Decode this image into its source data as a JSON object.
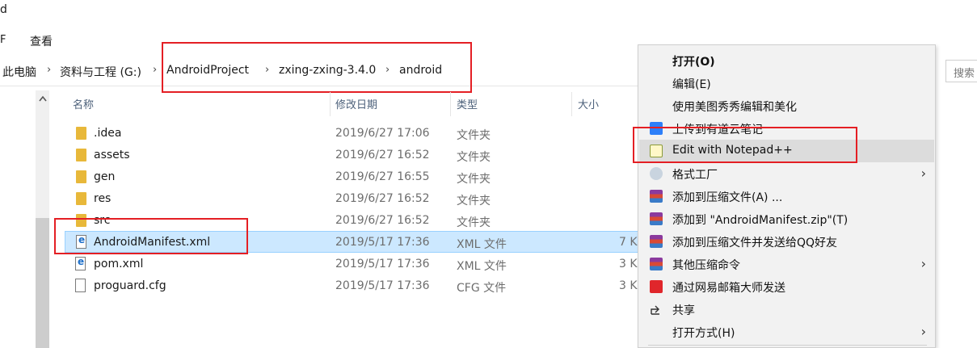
{
  "window": {
    "title_fragment": "d"
  },
  "ribbon": {
    "fragment": "F",
    "view_tab": "查看"
  },
  "address": {
    "crumbs": [
      "此电脑",
      "资料与工程 (G:)",
      "AndroidProject",
      "zxing-zxing-3.4.0",
      "android"
    ],
    "separator": "›"
  },
  "search": {
    "placeholder": "搜索"
  },
  "columns": {
    "name": "名称",
    "date": "修改日期",
    "type": "类型",
    "size": "大小"
  },
  "files": [
    {
      "name": ".idea",
      "date": "2019/6/27 17:06",
      "type": "文件夹",
      "size": "",
      "icon": "folder-icon"
    },
    {
      "name": "assets",
      "date": "2019/6/27 16:52",
      "type": "文件夹",
      "size": "",
      "icon": "folder-icon"
    },
    {
      "name": "gen",
      "date": "2019/6/27 16:55",
      "type": "文件夹",
      "size": "",
      "icon": "folder-icon"
    },
    {
      "name": "res",
      "date": "2019/6/27 16:52",
      "type": "文件夹",
      "size": "",
      "icon": "folder-icon"
    },
    {
      "name": "src",
      "date": "2019/6/27 16:52",
      "type": "文件夹",
      "size": "",
      "icon": "folder-icon"
    },
    {
      "name": "AndroidManifest.xml",
      "date": "2019/5/17 17:36",
      "type": "XML 文件",
      "size": "7 K",
      "icon": "xml-file-icon",
      "selected": true
    },
    {
      "name": "pom.xml",
      "date": "2019/5/17 17:36",
      "type": "XML 文件",
      "size": "3 K",
      "icon": "xml-file-icon"
    },
    {
      "name": "proguard.cfg",
      "date": "2019/5/17 17:36",
      "type": "CFG 文件",
      "size": "3 K",
      "icon": "file-icon"
    }
  ],
  "context_menu": {
    "items": [
      {
        "label": "打开(O)",
        "bold": true,
        "icon": ""
      },
      {
        "label": "编辑(E)",
        "icon": ""
      },
      {
        "label": "使用美图秀秀编辑和美化",
        "icon": ""
      },
      {
        "label": "上传到有道云笔记",
        "icon": "youdao-icon"
      },
      {
        "label": "Edit with Notepad++",
        "icon": "notepad-plus-plus-icon",
        "hover": true
      },
      {
        "label": "格式工厂",
        "icon": "format-factory-icon",
        "submenu": true
      },
      {
        "label": "添加到压缩文件(A) ...",
        "icon": "winrar-icon"
      },
      {
        "label": "添加到 \"AndroidManifest.zip\"(T)",
        "icon": "winrar-icon"
      },
      {
        "label": "添加到压缩文件并发送给QQ好友",
        "icon": "winrar-icon"
      },
      {
        "label": "其他压缩命令",
        "icon": "winrar-icon",
        "submenu": true
      },
      {
        "label": "通过网易邮箱大师发送",
        "icon": "netease-mail-icon"
      },
      {
        "label": "共享",
        "icon": "share-icon"
      },
      {
        "label": "打开方式(H)",
        "icon": "",
        "submenu": true
      }
    ],
    "arrow": "›"
  },
  "colors": {
    "selection": "#cce8ff",
    "highlight": "#e41f24",
    "folder": "#e8b83a"
  }
}
